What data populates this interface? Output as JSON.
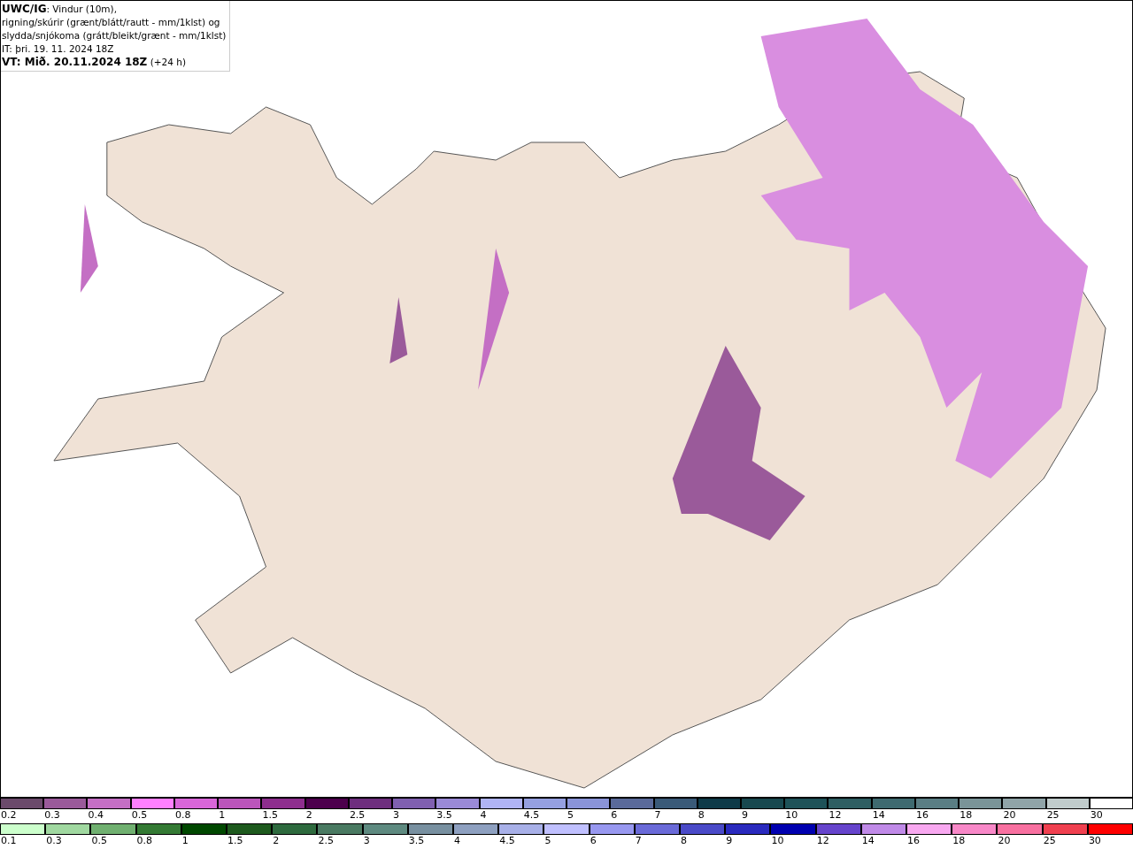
{
  "title_box": {
    "product": "UWC/IG",
    "description": ": Vindur (10m),\nrigning/skúrir (grænt/blátt/rautt - mm/1klst) og\nslydda/snjókoma (grátt/bleikt/grænt - mm/1klst)",
    "issue_time": "IT: þri. 19. 11. 2024 18Z",
    "valid_time": "VT: Mið. 20.11.2024 18Z",
    "lead": "(+24 h)"
  },
  "legends": [
    {
      "swatches": [
        {
          "label": "0.2",
          "color": "#6b4a6b"
        },
        {
          "label": "0.3",
          "color": "#9a5a9a"
        },
        {
          "label": "0.4",
          "color": "#c46fc4"
        },
        {
          "label": "0.5",
          "color": "#ff80ff"
        },
        {
          "label": "0.8",
          "color": "#d966d9"
        },
        {
          "label": "1",
          "color": "#bb55bb"
        },
        {
          "label": "1.5",
          "color": "#8e2e8e"
        },
        {
          "label": "2",
          "color": "#4d004d"
        },
        {
          "label": "2.5",
          "color": "#6e2e7e"
        },
        {
          "label": "3",
          "color": "#8060b0"
        },
        {
          "label": "3.5",
          "color": "#9a8ad6"
        },
        {
          "label": "4",
          "color": "#b0b4f4"
        },
        {
          "label": "4.5",
          "color": "#95a0e0"
        },
        {
          "label": "5",
          "color": "#8a94d8"
        },
        {
          "label": "6",
          "color": "#5a6a9a"
        },
        {
          "label": "7",
          "color": "#3a5a78"
        },
        {
          "label": "8",
          "color": "#0e3a48"
        },
        {
          "label": "9",
          "color": "#18484f"
        },
        {
          "label": "10",
          "color": "#1e5258"
        },
        {
          "label": "12",
          "color": "#2e5e62"
        },
        {
          "label": "14",
          "color": "#3e6a70"
        },
        {
          "label": "16",
          "color": "#5a7e84"
        },
        {
          "label": "18",
          "color": "#7a9498"
        },
        {
          "label": "20",
          "color": "#90a4a8"
        },
        {
          "label": "25",
          "color": "#c0cccc"
        },
        {
          "label": "30",
          "color": "#ffffff"
        }
      ]
    },
    {
      "swatches": [
        {
          "label": "0.1",
          "color": "#ccffcc"
        },
        {
          "label": "0.3",
          "color": "#a0d8a0"
        },
        {
          "label": "0.5",
          "color": "#70b070"
        },
        {
          "label": "0.8",
          "color": "#347a34"
        },
        {
          "label": "1",
          "color": "#004800"
        },
        {
          "label": "1.5",
          "color": "#1e5a1e"
        },
        {
          "label": "2",
          "color": "#2e6a3e"
        },
        {
          "label": "2.5",
          "color": "#4a7a62"
        },
        {
          "label": "3",
          "color": "#5e8a80"
        },
        {
          "label": "3.5",
          "color": "#7890a0"
        },
        {
          "label": "4",
          "color": "#8ea0c0"
        },
        {
          "label": "4.5",
          "color": "#a8b0e8"
        },
        {
          "label": "5",
          "color": "#c0c0ff"
        },
        {
          "label": "6",
          "color": "#9898f0"
        },
        {
          "label": "7",
          "color": "#6a6ad8"
        },
        {
          "label": "8",
          "color": "#4a4ac8"
        },
        {
          "label": "9",
          "color": "#2a2abe"
        },
        {
          "label": "10",
          "color": "#0000b0"
        },
        {
          "label": "12",
          "color": "#6644cc"
        },
        {
          "label": "14",
          "color": "#c08ae8"
        },
        {
          "label": "16",
          "color": "#f8a8f0"
        },
        {
          "label": "18",
          "color": "#f888c8"
        },
        {
          "label": "20",
          "color": "#f870a0"
        },
        {
          "label": "25",
          "color": "#f04050"
        },
        {
          "label": "30",
          "color": "#ff0000"
        }
      ]
    }
  ]
}
